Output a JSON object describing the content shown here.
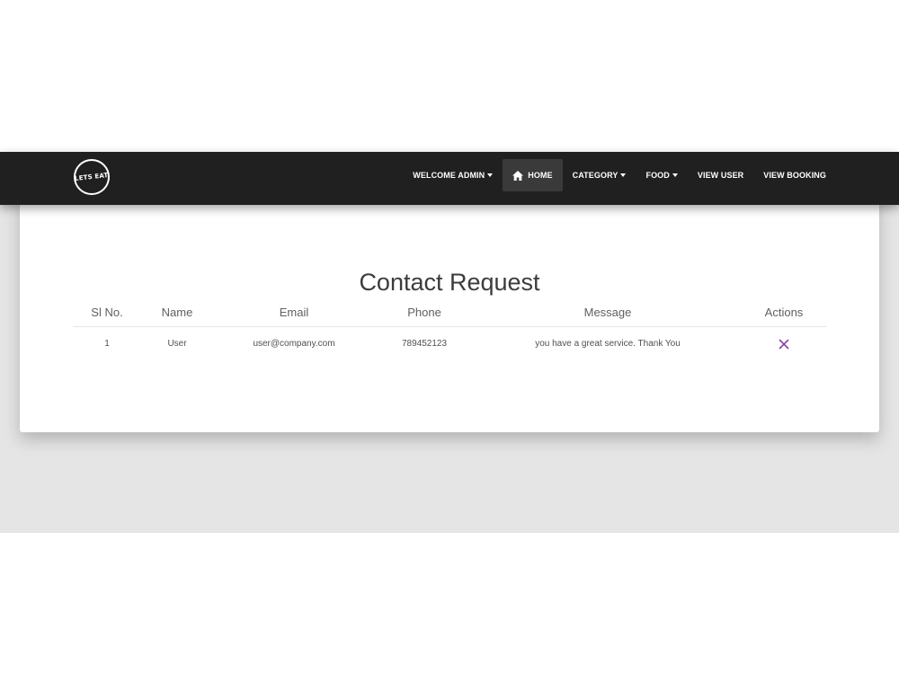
{
  "navbar": {
    "logo_text": "LETS EAT",
    "items": [
      {
        "label": "WELCOME ADMIN",
        "dropdown": true
      },
      {
        "label": "HOME",
        "icon": "home-icon",
        "active": true
      },
      {
        "label": "CATEGORY",
        "dropdown": true
      },
      {
        "label": "FOOD",
        "dropdown": true
      },
      {
        "label": "VIEW USER"
      },
      {
        "label": "VIEW BOOKING"
      }
    ]
  },
  "main": {
    "title": "Contact Request",
    "table": {
      "headers": [
        "Sl No.",
        "Name",
        "Email",
        "Phone",
        "Message",
        "Actions"
      ],
      "rows": [
        {
          "sl_no": "1",
          "name": "User",
          "email": "user@company.com",
          "phone": "789452123",
          "message": "you have a great service. Thank You",
          "action_icon": "close-icon"
        }
      ]
    }
  },
  "colors": {
    "navbar_bg": "#202020",
    "navbar_active_bg": "#3a3a3a",
    "page_bg": "#e5e5e5",
    "delete_icon": "#8e3fa0"
  }
}
